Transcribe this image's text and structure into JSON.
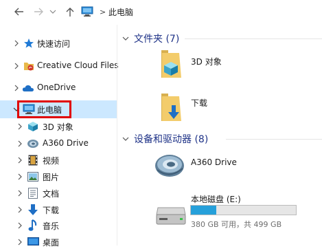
{
  "address": {
    "separator": ">",
    "location": "此电脑"
  },
  "nav": {
    "items": [
      {
        "label": "快速访问"
      },
      {
        "label": "Creative Cloud Files"
      },
      {
        "label": "OneDrive"
      },
      {
        "label": "此电脑"
      },
      {
        "label": "3D 对象"
      },
      {
        "label": "A360 Drive"
      },
      {
        "label": "视频"
      },
      {
        "label": "图片"
      },
      {
        "label": "文档"
      },
      {
        "label": "下载"
      },
      {
        "label": "音乐"
      },
      {
        "label": "桌面"
      }
    ]
  },
  "groups": {
    "folders": {
      "title": "文件夹 (7)",
      "items": [
        {
          "label": "3D 对象"
        },
        {
          "label": "下载"
        }
      ]
    },
    "devices": {
      "title": "设备和驱动器 (8)",
      "items": [
        {
          "label": "A360 Drive"
        },
        {
          "label": "本地磁盘 (E:)",
          "caption": "380 GB 可用，共 499 GB",
          "used_fraction": 0.24
        }
      ]
    }
  },
  "colors": {
    "selection": "#cce8ff",
    "highlight": "#e00000",
    "group_title": "#1e3287",
    "drive_bar": "#26a0da"
  }
}
